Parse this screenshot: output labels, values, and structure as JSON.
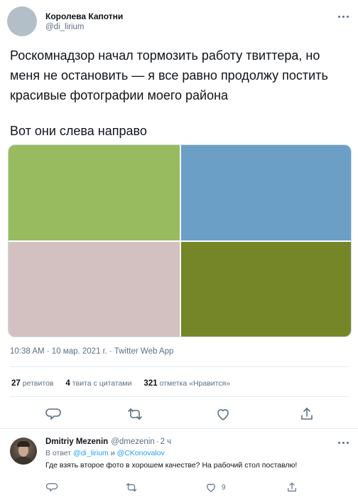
{
  "tweet": {
    "author": {
      "name": "Королева Капотни",
      "handle": "@di_lirium"
    },
    "text": "Роскомнадзор начал тормозить работу твиттера, но меня не остановить — я все равно продолжу постить красивые фотографии моего района",
    "text2": "Вот они слева направо",
    "photos": [
      {
        "color": "#98bb5f"
      },
      {
        "color": "#6b9fc6"
      },
      {
        "color": "#d3c1c1"
      },
      {
        "color": "#758629"
      }
    ],
    "meta": "10:38 AM · 10 мар. 2021 г. · Twitter Web App",
    "stats": {
      "retweets_count": "27",
      "retweets_label": "ретвитов",
      "quotes_count": "4",
      "quotes_label": "твита с цитатами",
      "likes_count": "321",
      "likes_label": "отметка «Нравится»"
    },
    "actions": [
      "reply-icon",
      "retweet-icon",
      "like-icon",
      "share-icon"
    ]
  },
  "reply": {
    "name": "Dmitriy Mezenin",
    "handle": "@dmezenin",
    "dot": "·",
    "time": "2 ч",
    "reply_prefix": "В ответ",
    "mention1": "@di_lirium",
    "and": "и",
    "mention2": "@CKonovalov",
    "text": "Где взять второе фото в хорошем качестве? На рабочий стол поставлю!",
    "like_count": "9"
  },
  "colors": {
    "accent": "#1da1f2",
    "secondary_text": "#5b7083",
    "border": "#e6ecf0"
  }
}
